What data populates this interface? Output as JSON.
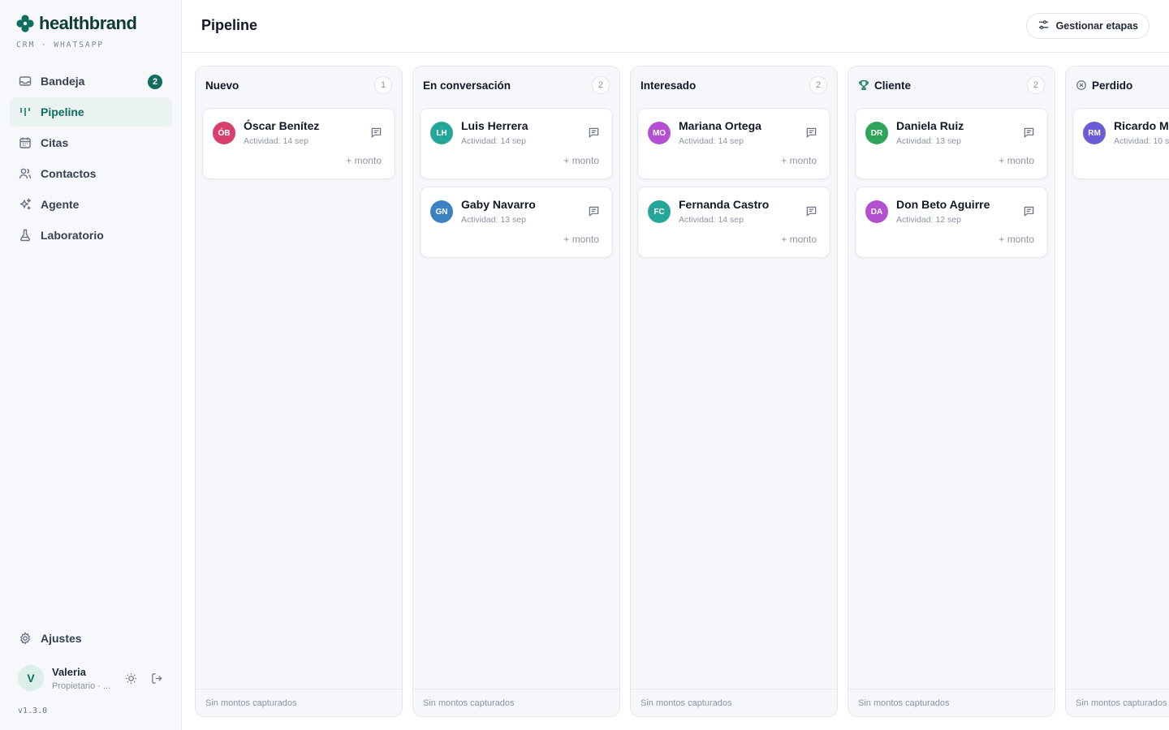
{
  "brand": {
    "name": "healthbrand",
    "subtitle": "CRM · WHATSAPP",
    "color": "#0f6e5e"
  },
  "sidebar": {
    "items": [
      {
        "label": "Bandeja",
        "icon": "inbox-icon",
        "badge": "2"
      },
      {
        "label": "Pipeline",
        "icon": "pipeline-icon",
        "active": true
      },
      {
        "label": "Citas",
        "icon": "calendar-icon"
      },
      {
        "label": "Contactos",
        "icon": "users-icon"
      },
      {
        "label": "Agente",
        "icon": "sparkles-icon"
      },
      {
        "label": "Laboratorio",
        "icon": "flask-icon"
      }
    ],
    "settings_label": "Ajustes",
    "user": {
      "initial": "V",
      "name": "Valeria",
      "role": "Propietario · ..."
    },
    "version": "v1.3.0"
  },
  "header": {
    "title": "Pipeline",
    "manage_label": "Gestionar etapas"
  },
  "columns": [
    {
      "title": "Nuevo",
      "count": "1",
      "footer": "Sin montos capturados",
      "cards": [
        {
          "initials": "ÓB",
          "name": "Óscar Benítez",
          "activity": "Actividad: 14 sep",
          "amount": "+ monto",
          "color": "#d6406c"
        }
      ]
    },
    {
      "title": "En conversación",
      "count": "2",
      "footer": "Sin montos capturados",
      "cards": [
        {
          "initials": "LH",
          "name": "Luis Herrera",
          "activity": "Actividad: 14 sep",
          "amount": "+ monto",
          "color": "#26a69a"
        },
        {
          "initials": "GN",
          "name": "Gaby Navarro",
          "activity": "Actividad: 13 sep",
          "amount": "+ monto",
          "color": "#3b82c4"
        }
      ]
    },
    {
      "title": "Interesado",
      "count": "2",
      "footer": "Sin montos capturados",
      "cards": [
        {
          "initials": "MO",
          "name": "Mariana Ortega",
          "activity": "Actividad: 14 sep",
          "amount": "+ monto",
          "color": "#b34fd1"
        },
        {
          "initials": "FC",
          "name": "Fernanda Castro",
          "activity": "Actividad: 14 sep",
          "amount": "+ monto",
          "color": "#26a69a"
        }
      ]
    },
    {
      "title": "Cliente",
      "count": "2",
      "footer": "Sin montos capturados",
      "icon": "trophy-icon",
      "cards": [
        {
          "initials": "DR",
          "name": "Daniela Ruiz",
          "activity": "Actividad: 13 sep",
          "amount": "+ monto",
          "color": "#2ea55a"
        },
        {
          "initials": "DA",
          "name": "Don Beto Aguirre",
          "activity": "Actividad: 12 sep",
          "amount": "+ monto",
          "color": "#b34fd1"
        }
      ]
    },
    {
      "title": "Perdido",
      "count": "",
      "footer": "Sin montos capturados",
      "icon": "x-circle-icon",
      "cards": [
        {
          "initials": "RM",
          "name": "Ricardo Mo",
          "activity": "Actividad: 10 s",
          "amount": "",
          "color": "#6b5bd6"
        }
      ]
    }
  ]
}
